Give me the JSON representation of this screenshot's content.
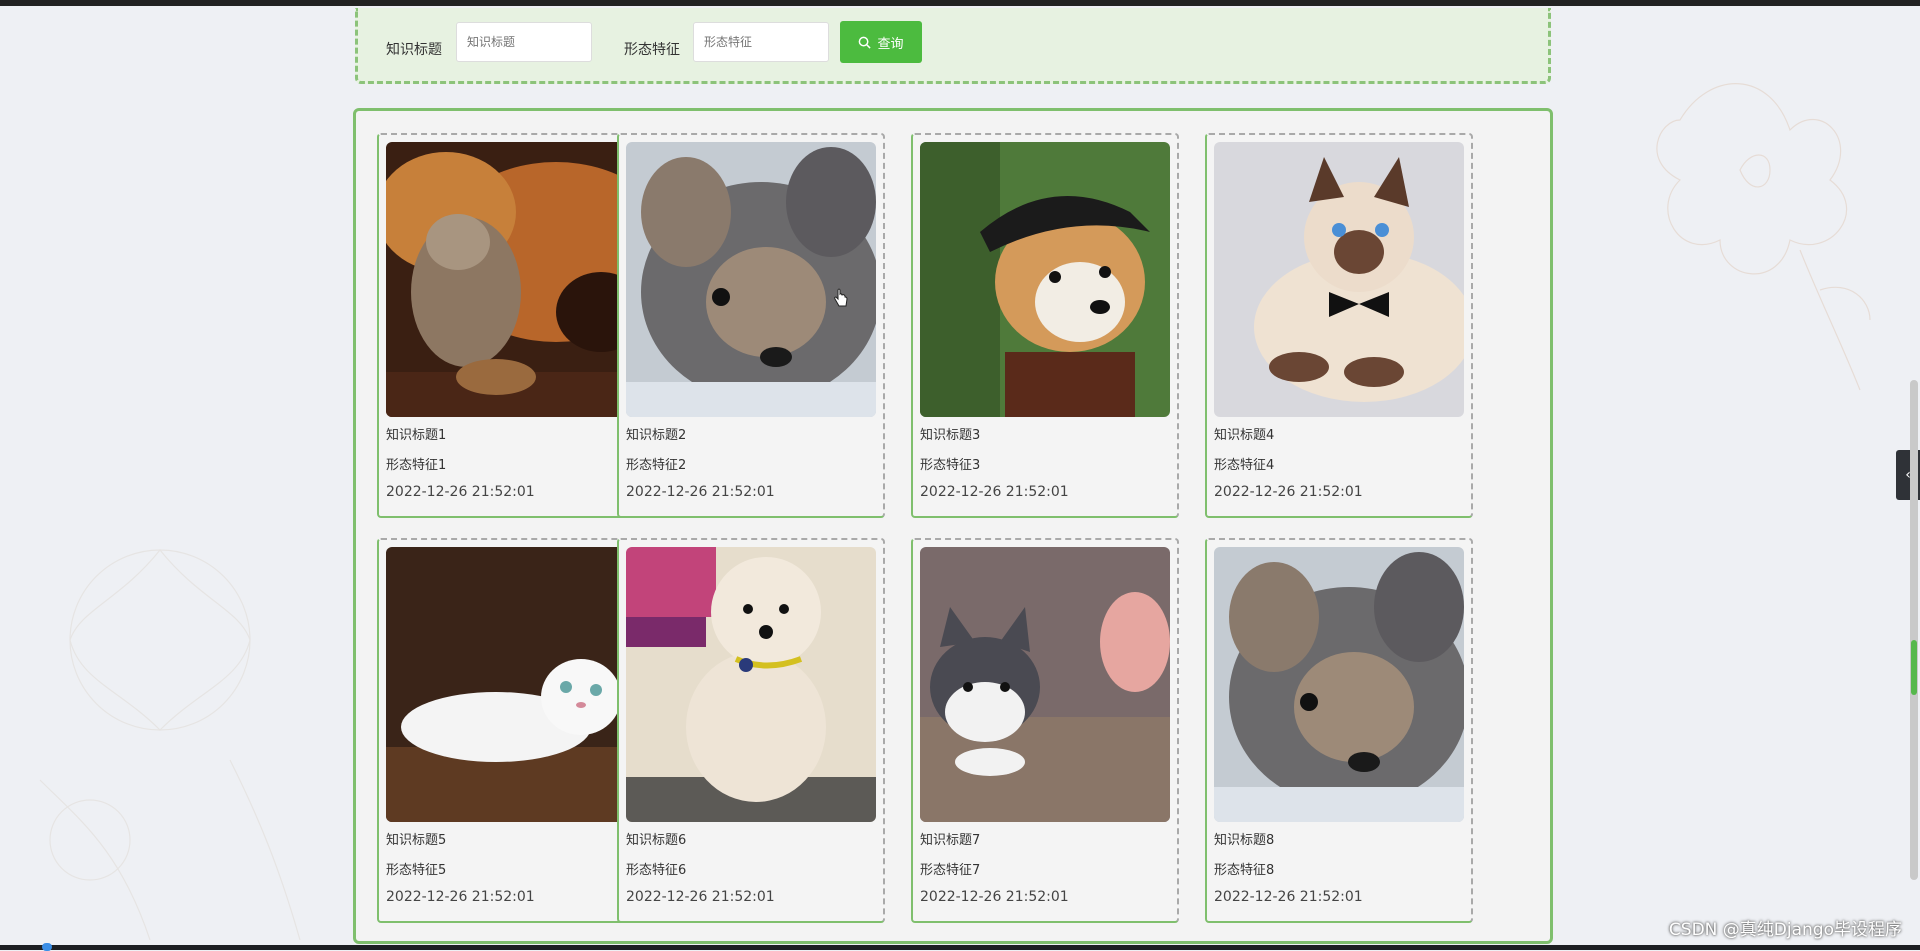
{
  "search": {
    "title_label": "知识标题",
    "title_placeholder": "知识标题",
    "feature_label": "形态特征",
    "feature_placeholder": "形态特征",
    "button_label": "查询"
  },
  "cards": [
    {
      "title": "知识标题1",
      "feature": "形态特征1",
      "time": "2022-12-26 21:52:01",
      "image": "cat-and-dog-photo"
    },
    {
      "title": "知识标题2",
      "feature": "形态特征2",
      "time": "2022-12-26 21:52:01",
      "image": "gray-puppy-photo"
    },
    {
      "title": "知识标题3",
      "feature": "形态特征3",
      "time": "2022-12-26 21:52:01",
      "image": "corgi-pirate-photo"
    },
    {
      "title": "知识标题4",
      "feature": "形态特征4",
      "time": "2022-12-26 21:52:01",
      "image": "siamese-cat-bowtie-photo"
    },
    {
      "title": "知识标题5",
      "feature": "形态特征5",
      "time": "2022-12-26 21:52:01",
      "image": "white-fold-cat-photo"
    },
    {
      "title": "知识标题6",
      "feature": "形态特征6",
      "time": "2022-12-26 21:52:01",
      "image": "poodle-photo"
    },
    {
      "title": "知识标题7",
      "feature": "形态特征7",
      "time": "2022-12-26 21:52:01",
      "image": "gray-white-cat-photo"
    },
    {
      "title": "知识标题8",
      "feature": "形态特征8",
      "time": "2022-12-26 21:52:01",
      "image": "gray-puppy-photo"
    }
  ],
  "watermark": "CSDN @真纯Django毕设程序",
  "side_tab_icon": "chevron-left-icon",
  "colors": {
    "accent": "#4cbb3f",
    "panel_border": "#7fbf6d"
  }
}
